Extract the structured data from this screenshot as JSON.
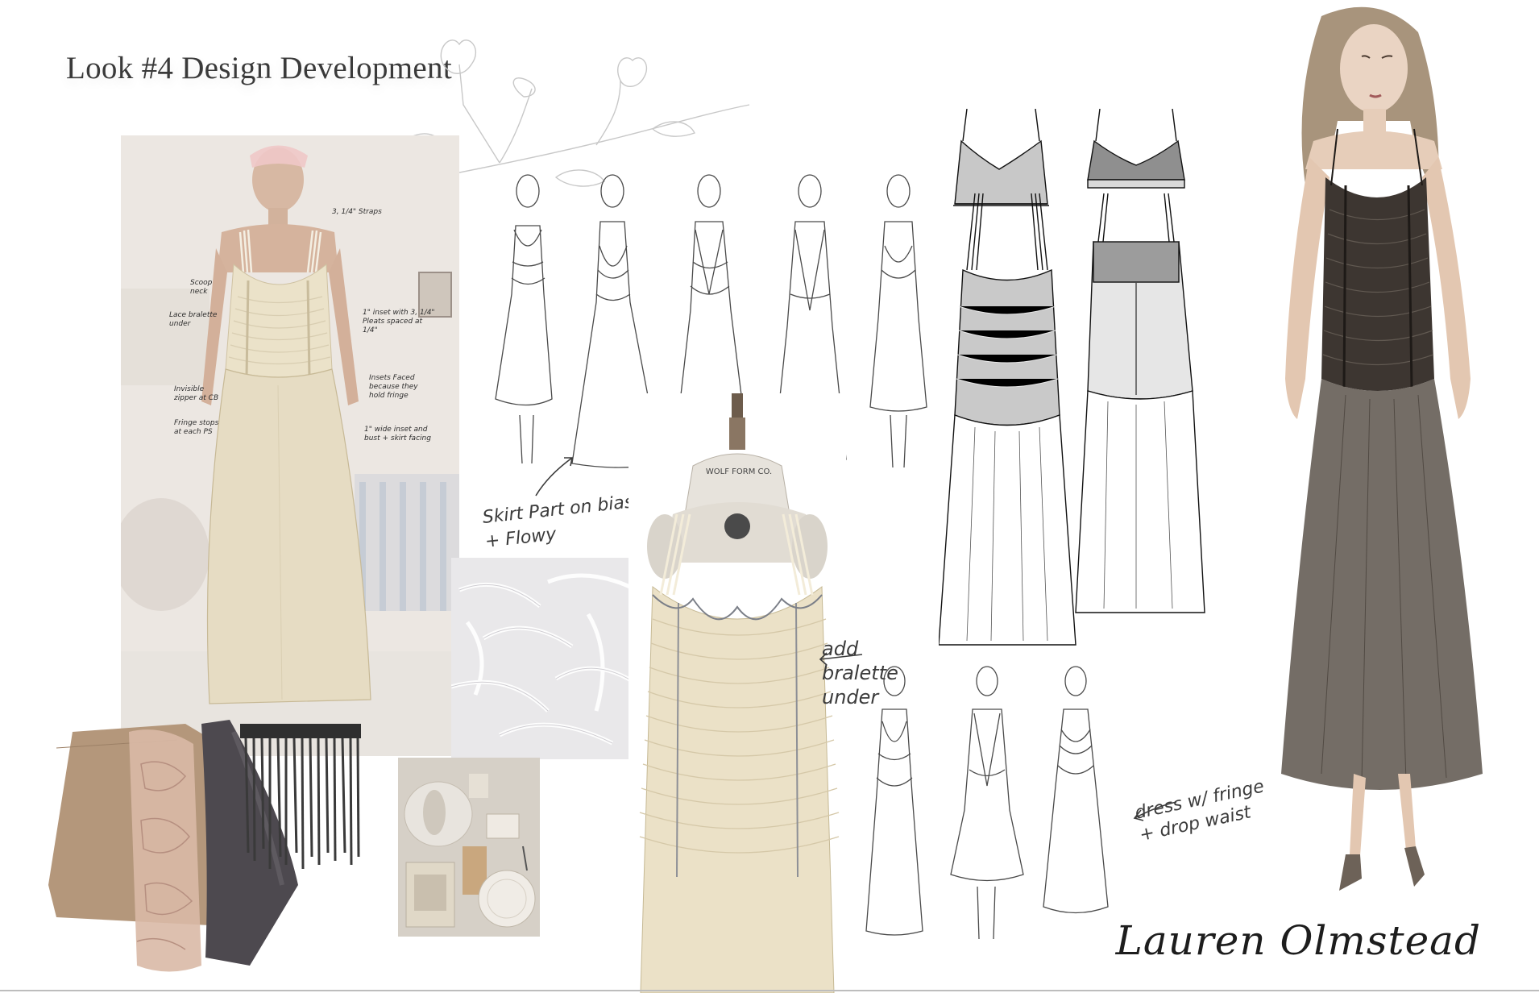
{
  "board": {
    "title": "Look #4 Design Development",
    "signature": "Lauren Olmstead"
  },
  "photo_annotations": [
    "3, 1/4\" Straps",
    "Scoop neck",
    "Lace bralette under",
    "1\" inset with 3, 1/4\" Pleats spaced at 1/4\"",
    "Invisible zipper at CB",
    "Insets Faced because they hold fringe",
    "Fringe stops at each PS",
    "1\" wide inset and bust + skirt facing"
  ],
  "sketch_notes": {
    "skirt_note": "Skirt Part on bias + Flowy",
    "bralette_note": "add bralette under",
    "dress_note": "dress w/ fringe + drop waist"
  },
  "dress_form_label": "WOLF FORM CO.",
  "colors": {
    "muslin": "#e9e0c9",
    "fabric_tan": "#b79a7e",
    "fabric_charcoal": "#4e4a4e",
    "illustration_dress": "#3b3530",
    "sketch_line": "#444444"
  }
}
